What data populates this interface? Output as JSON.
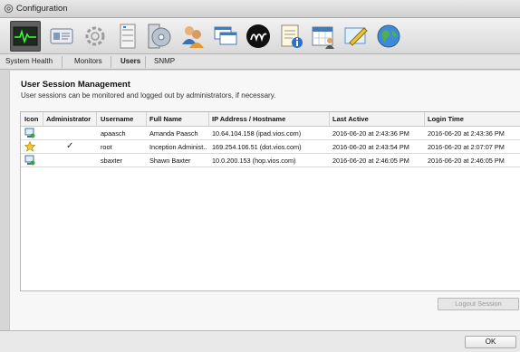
{
  "window": {
    "title": "Configuration"
  },
  "toolbar": {
    "icons": [
      "system-health-icon",
      "id-card-icon",
      "gear-icon",
      "server-rack-icon",
      "disk-icon",
      "users-icon",
      "windows-icon",
      "signature-icon",
      "notepad-info-icon",
      "calendar-user-icon",
      "pencil-screen-icon",
      "globe-icon"
    ],
    "selected": "system-health-icon"
  },
  "tabs": [
    {
      "label": "System Health"
    },
    {
      "label": "Monitors"
    },
    {
      "label": "Users",
      "active": true
    },
    {
      "label": "SNMP"
    }
  ],
  "main": {
    "heading": "User Session Management",
    "subtext": "User sessions can be monitored and logged out by administrators, if necessary."
  },
  "table": {
    "columns": [
      "Icon",
      "Administrator",
      "Username",
      "Full Name",
      "IP Address / Hostname",
      "Last Active",
      "Login Time"
    ],
    "rows": [
      {
        "icon": "user-session-icon",
        "admin": "",
        "username": "apaasch",
        "full_name": "Amanda Paasch",
        "ip": "10.64.104.158 (ipad.vios.com)",
        "last_active": "2016-06-20 at 2:43:36 PM",
        "login_time": "2016-06-20 at 2:43:36 PM"
      },
      {
        "icon": "admin-star-icon",
        "admin": "✓",
        "username": "root",
        "full_name": "Inception Administ...",
        "ip": "169.254.106.51 (dot.vios.com)",
        "last_active": "2016-06-20 at 2:43:54 PM",
        "login_time": "2016-06-20 at 2:07:07 PM"
      },
      {
        "icon": "user-session-icon",
        "admin": "",
        "username": "sbaxter",
        "full_name": "Shawn Baxter",
        "ip": "10.0.200.153 (hop.vios.com)",
        "last_active": "2016-06-20 at 2:46:05 PM",
        "login_time": "2016-06-20 at 2:46:05 PM"
      }
    ]
  },
  "buttons": {
    "logout": "Logout Session",
    "ok": "OK"
  }
}
